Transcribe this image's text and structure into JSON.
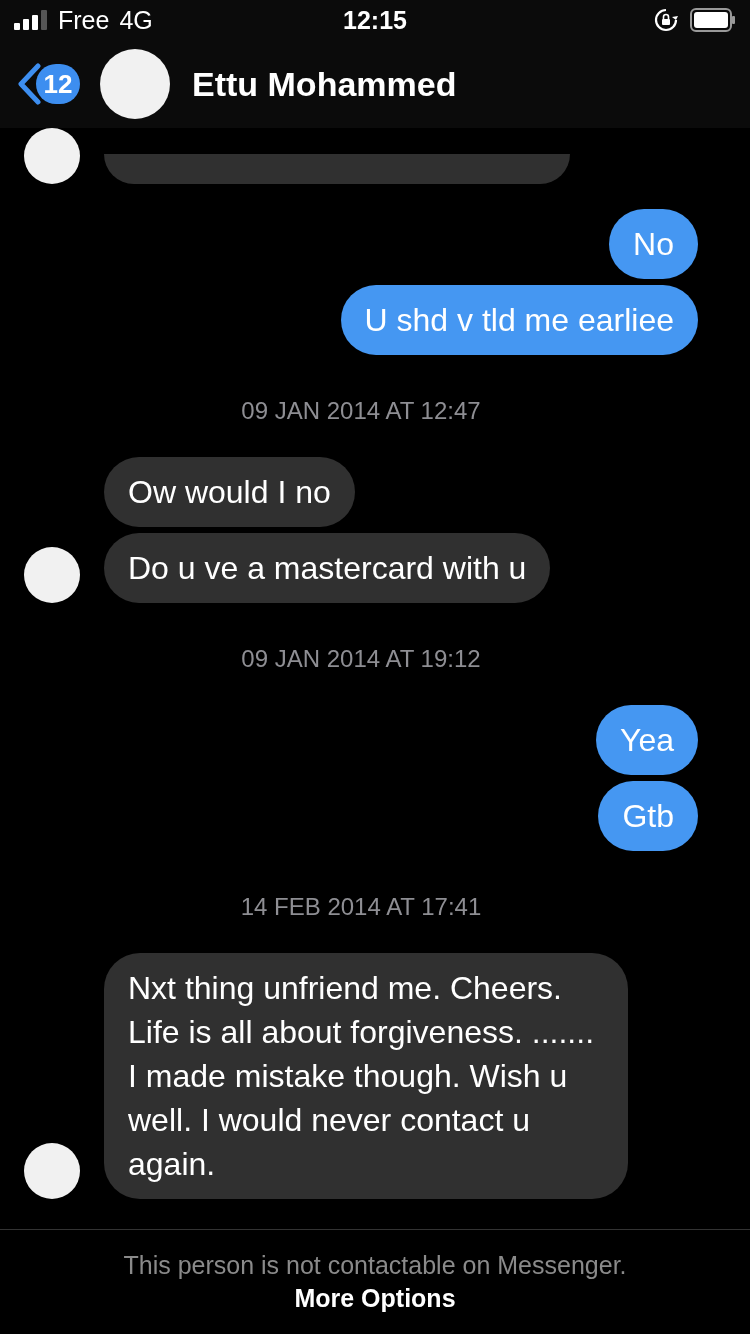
{
  "status_bar": {
    "carrier": "Free",
    "network": "4G",
    "time": "12:15"
  },
  "header": {
    "back_badge": "12",
    "contact_name": "Ettu Mohammed"
  },
  "thread": [
    {
      "kind": "incoming_partial"
    },
    {
      "kind": "outgoing",
      "messages": [
        "No",
        "U shd v tld me earliee"
      ]
    },
    {
      "kind": "timestamp",
      "text": "09 JAN 2014 AT 12:47"
    },
    {
      "kind": "incoming",
      "messages": [
        "Ow would I no",
        "Do u ve a mastercard with u"
      ]
    },
    {
      "kind": "timestamp",
      "text": "09 JAN 2014 AT 19:12"
    },
    {
      "kind": "outgoing",
      "messages": [
        "Yea",
        "Gtb"
      ]
    },
    {
      "kind": "timestamp",
      "text": "14 FEB 2014 AT 17:41"
    },
    {
      "kind": "incoming",
      "messages": [
        "Nxt thing unfriend me. Cheers. Life is all about forgiveness. ....... I made mistake though. Wish u well. I would never contact u again."
      ]
    }
  ],
  "footer": {
    "notice": "This person is not contactable on Messenger.",
    "action": "More Options"
  }
}
